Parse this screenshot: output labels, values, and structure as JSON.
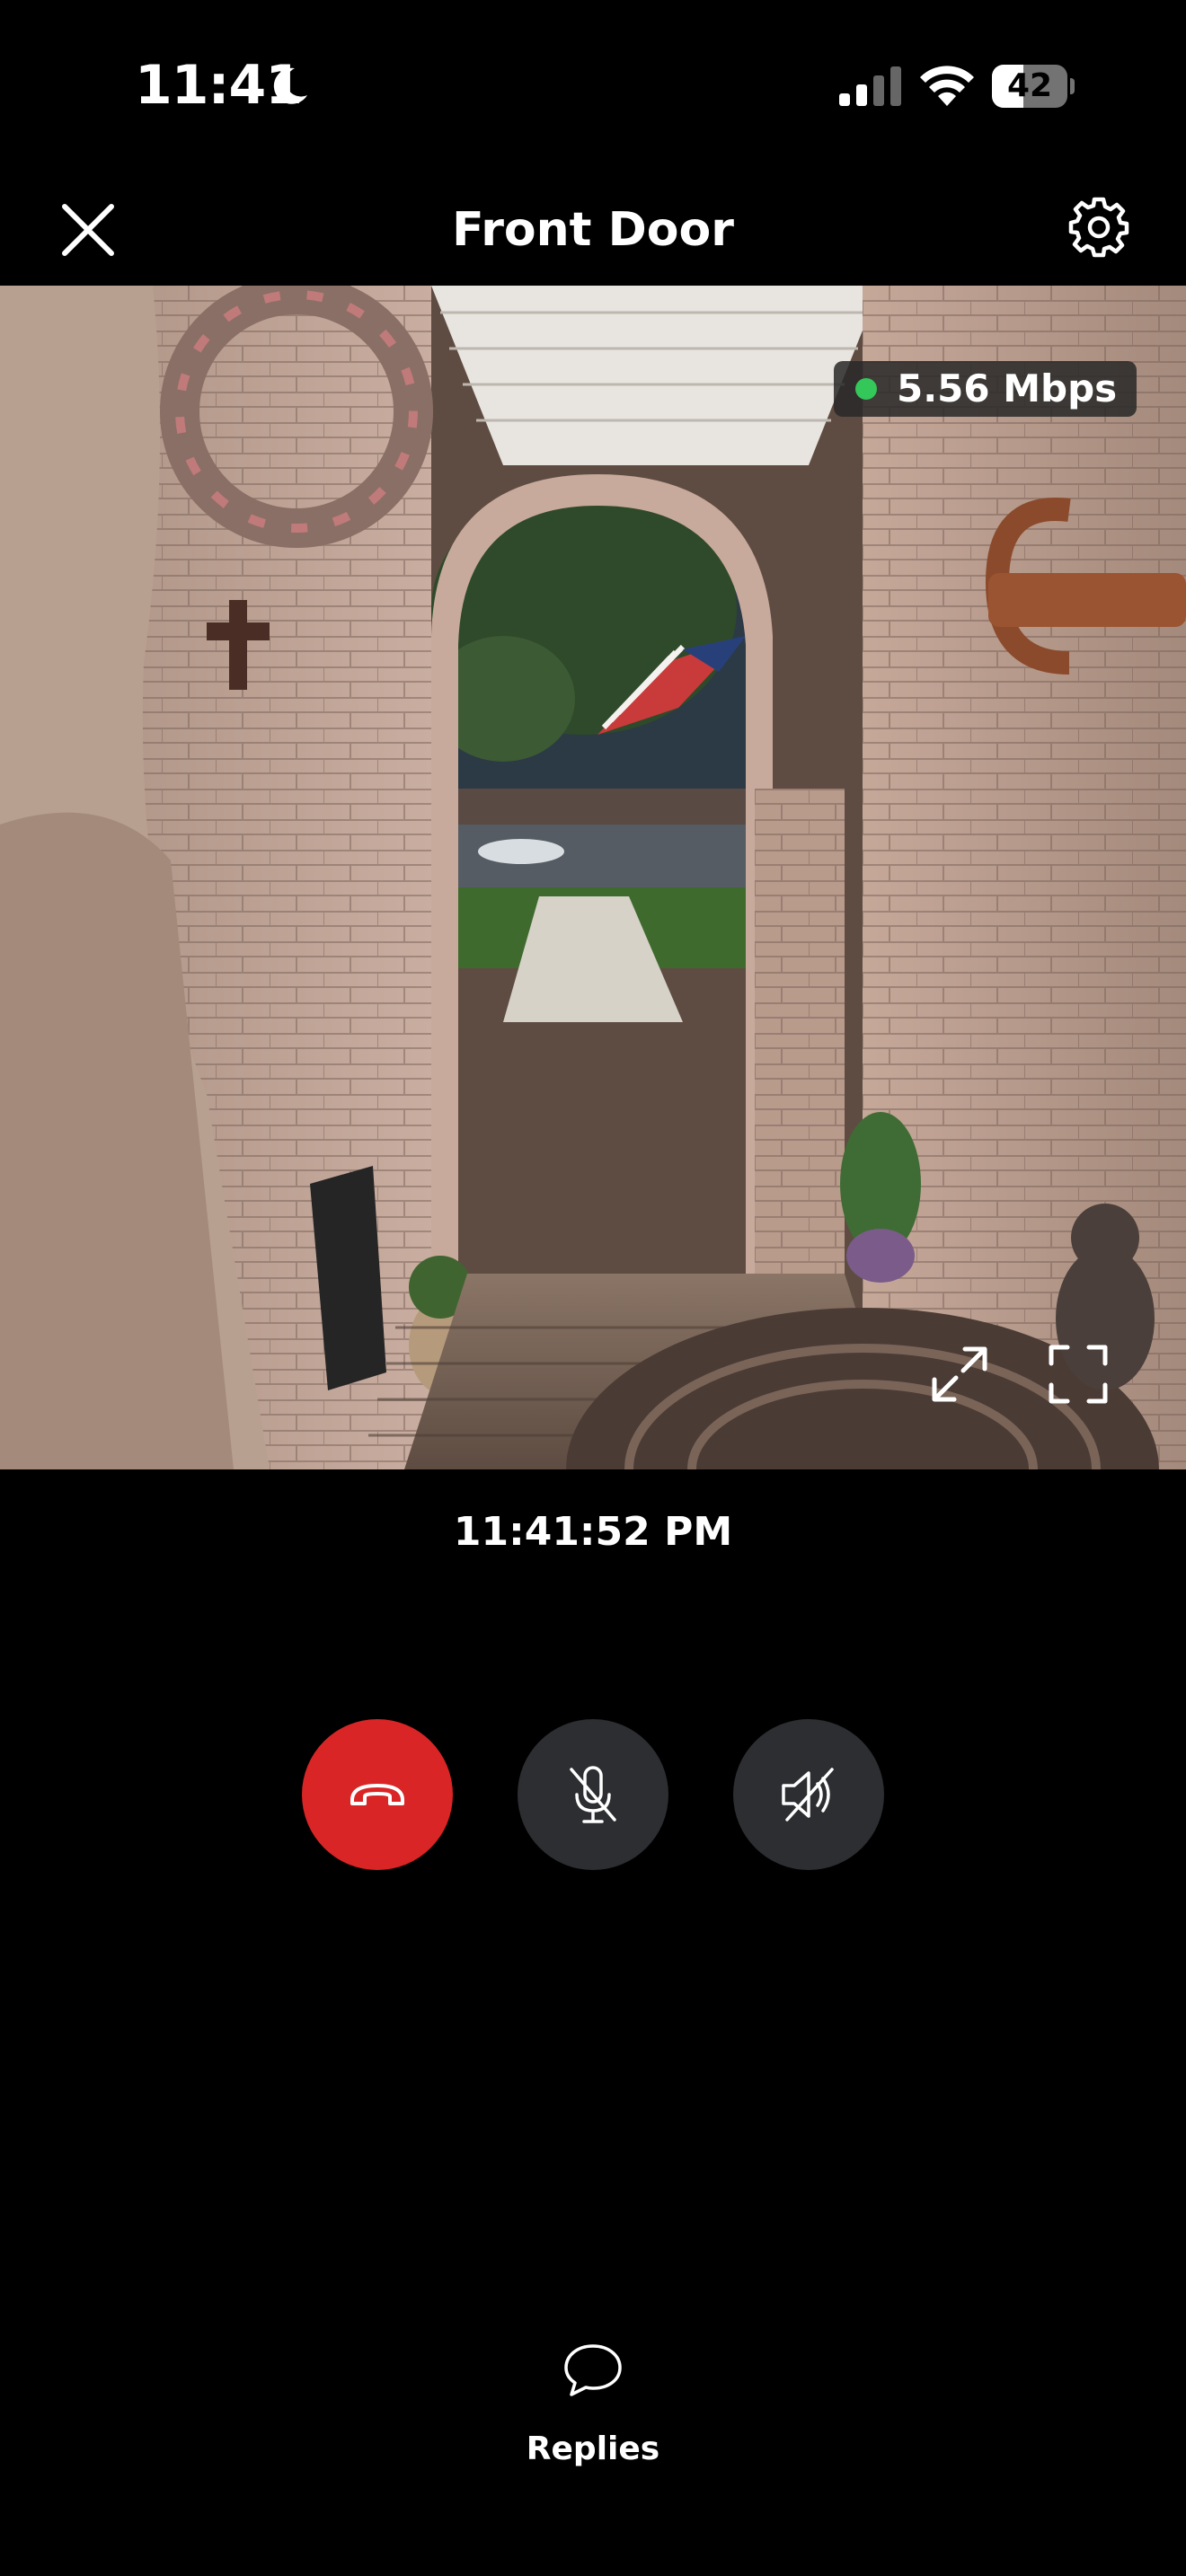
{
  "status_bar": {
    "time": "11:41",
    "battery_percent": 42,
    "battery_label": "42",
    "icons": [
      "moon-icon",
      "cellular-signal-icon",
      "wifi-icon",
      "battery-icon"
    ]
  },
  "header": {
    "title": "Front Door",
    "close_icon": "close-icon",
    "settings_icon": "gear-icon"
  },
  "video": {
    "bitrate": "5.56 Mbps",
    "live_indicator_color": "#34c759",
    "controls": [
      "expand-icon",
      "fullscreen-icon"
    ]
  },
  "timestamp": "11:41:52 PM",
  "call_controls": [
    {
      "name": "hangup",
      "icon": "phone-hangup-icon",
      "color": "#d92525"
    },
    {
      "name": "mute-mic",
      "icon": "mic-off-icon",
      "color": "#2c2e31"
    },
    {
      "name": "speaker",
      "icon": "speaker-off-icon",
      "color": "#2c2e31"
    }
  ],
  "replies": {
    "label": "Replies",
    "icon": "chat-bubble-icon"
  }
}
